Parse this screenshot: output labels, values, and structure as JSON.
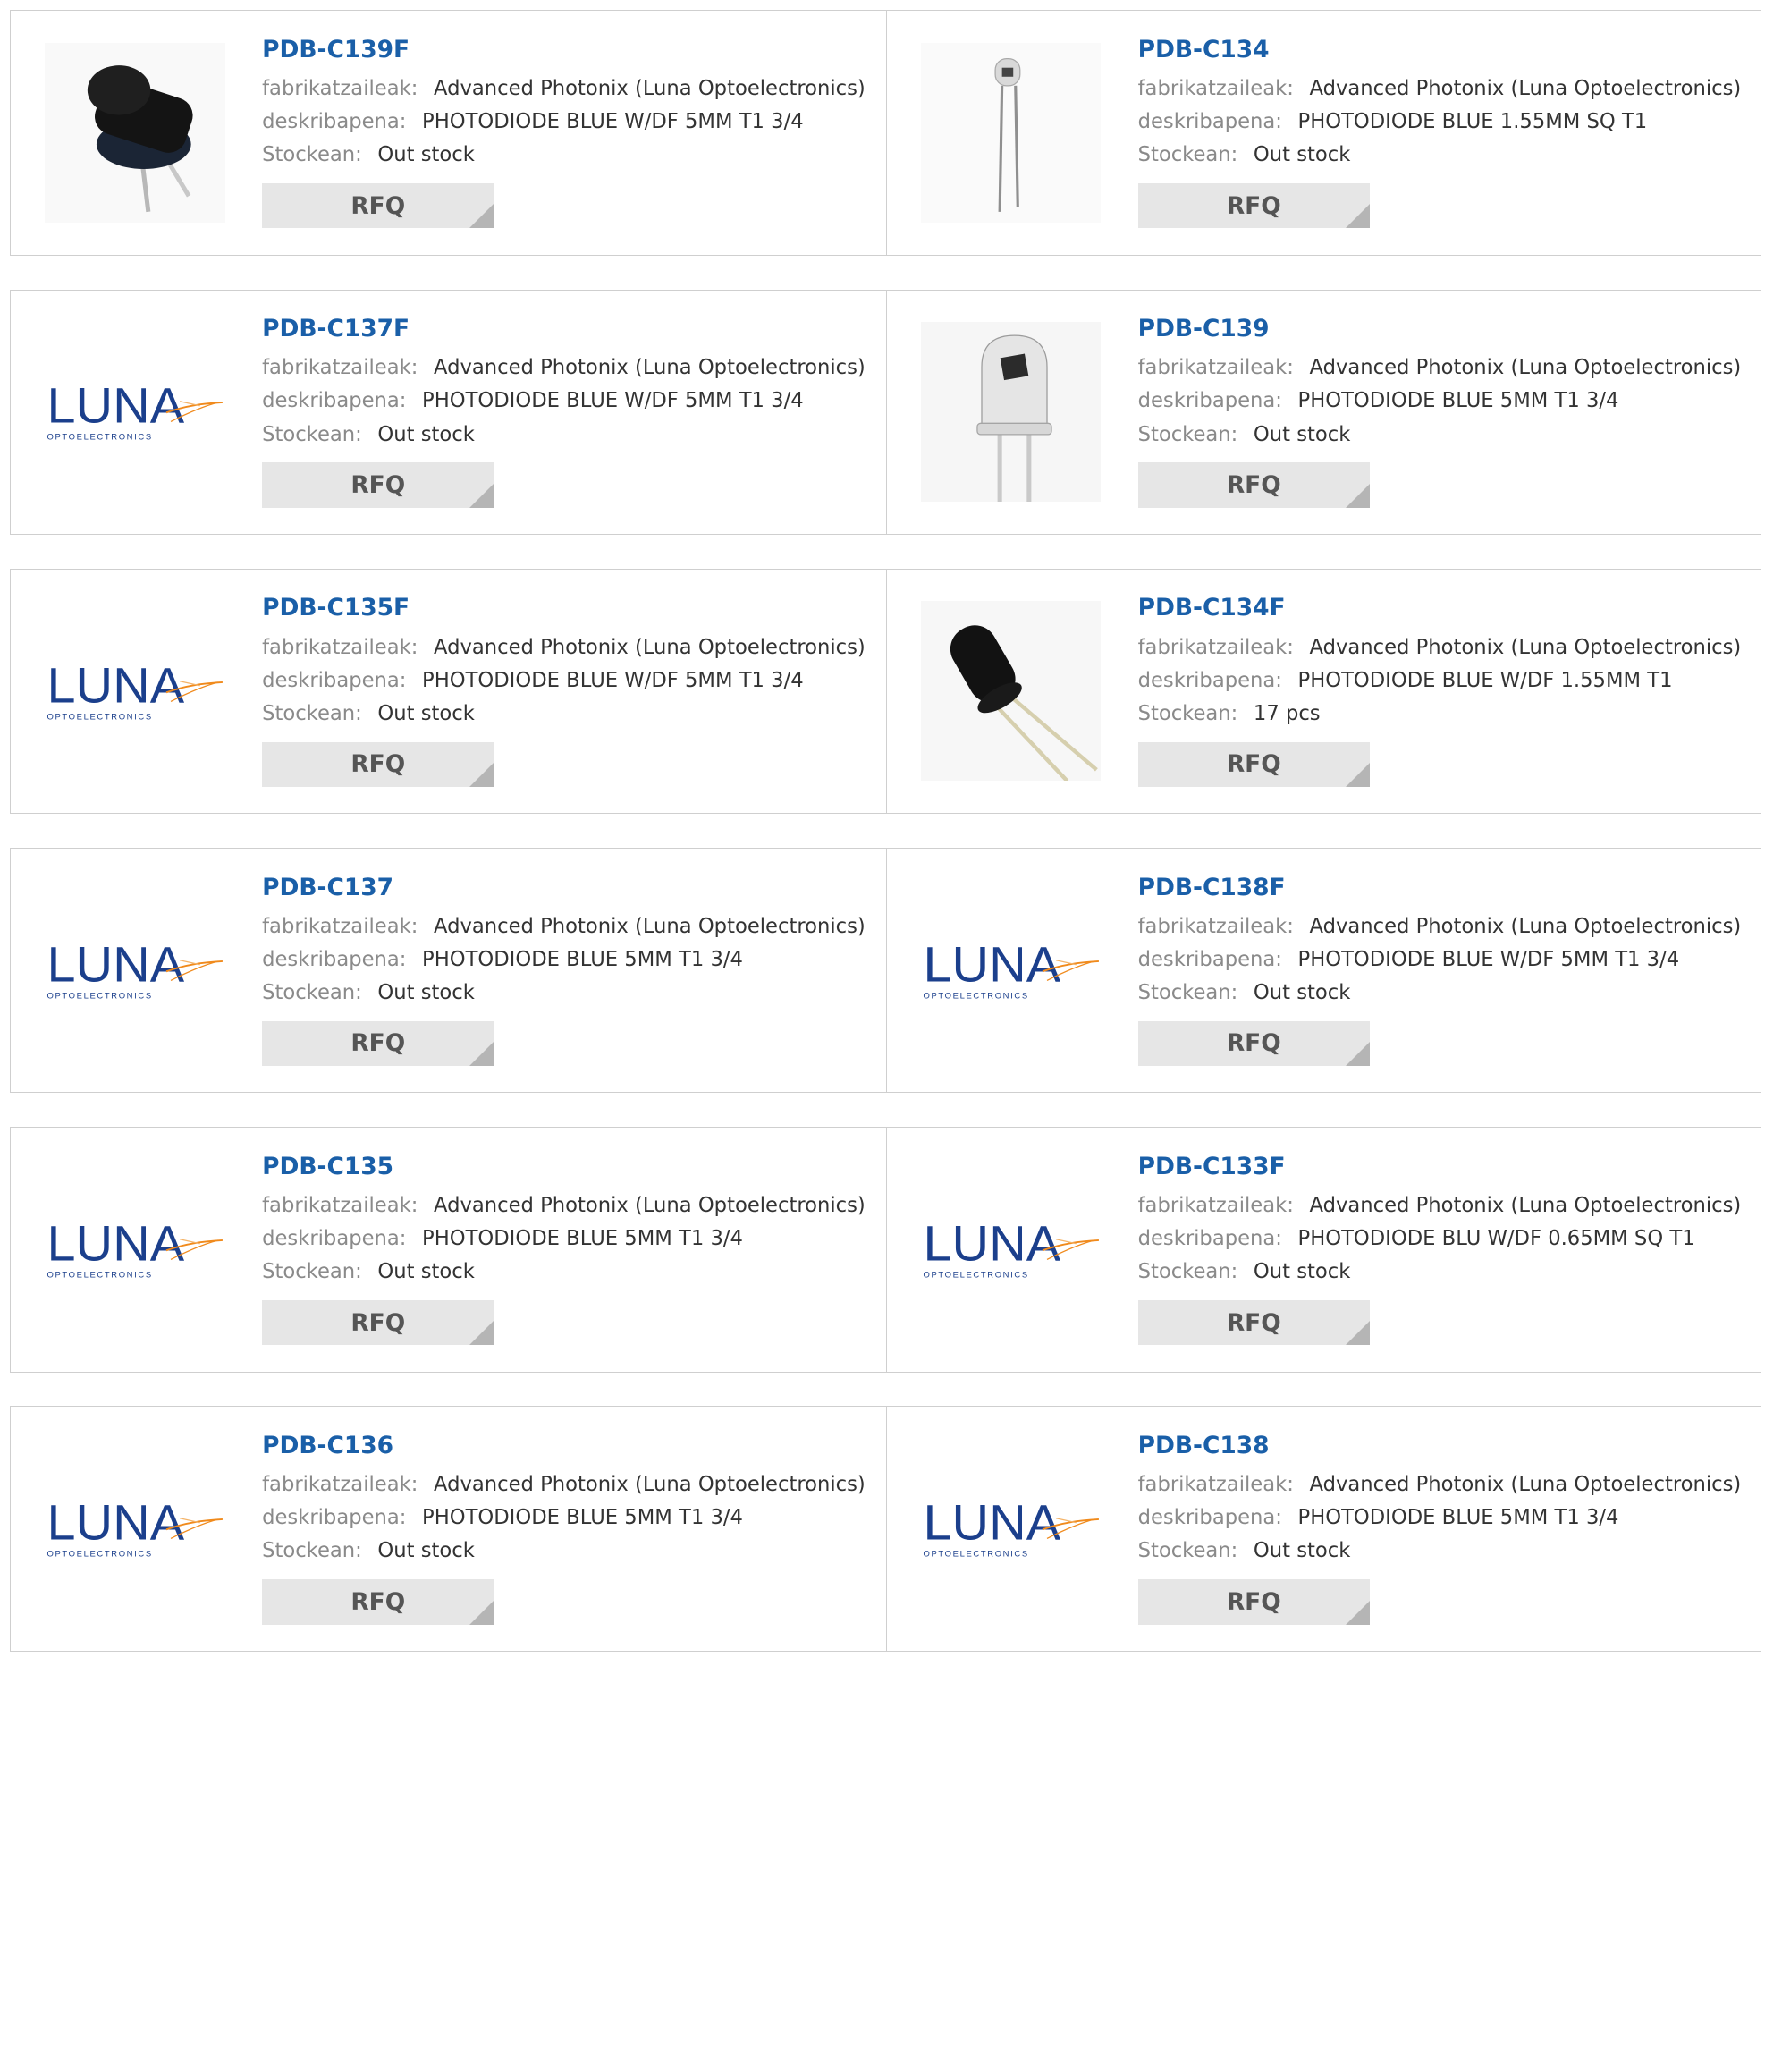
{
  "labels": {
    "manufacturer": "fabrikatzaileak:",
    "description": "deskribapena:",
    "stock": "Stockean:",
    "rfq": "RFQ"
  },
  "logo_text": {
    "main": "LUNA",
    "sub": "OPTOELECTRONICS"
  },
  "products": [
    {
      "pn": "PDB-C139F",
      "manufacturer": "Advanced Photonix (Luna Optoelectronics)",
      "description": "PHOTODIODE BLUE W/DF 5MM T1 3/4",
      "stock": "Out stock",
      "image": "black-photodiode-short"
    },
    {
      "pn": "PDB-C134",
      "manufacturer": "Advanced Photonix (Luna Optoelectronics)",
      "description": "PHOTODIODE BLUE 1.55MM SQ T1",
      "stock": "Out stock",
      "image": "small-clear-photodiode"
    },
    {
      "pn": "PDB-C137F",
      "manufacturer": "Advanced Photonix (Luna Optoelectronics)",
      "description": "PHOTODIODE BLUE W/DF 5MM T1 3/4",
      "stock": "Out stock",
      "image": "luna-logo"
    },
    {
      "pn": "PDB-C139",
      "manufacturer": "Advanced Photonix (Luna Optoelectronics)",
      "description": "PHOTODIODE BLUE 5MM T1 3/4",
      "stock": "Out stock",
      "image": "clear-photodiode"
    },
    {
      "pn": "PDB-C135F",
      "manufacturer": "Advanced Photonix (Luna Optoelectronics)",
      "description": "PHOTODIODE BLUE W/DF 5MM T1 3/4",
      "stock": "Out stock",
      "image": "luna-logo"
    },
    {
      "pn": "PDB-C134F",
      "manufacturer": "Advanced Photonix (Luna Optoelectronics)",
      "description": "PHOTODIODE BLUE W/DF 1.55MM T1",
      "stock": "17 pcs",
      "image": "black-photodiode-tilted"
    },
    {
      "pn": "PDB-C137",
      "manufacturer": "Advanced Photonix (Luna Optoelectronics)",
      "description": "PHOTODIODE BLUE 5MM T1 3/4",
      "stock": "Out stock",
      "image": "luna-logo"
    },
    {
      "pn": "PDB-C138F",
      "manufacturer": "Advanced Photonix (Luna Optoelectronics)",
      "description": "PHOTODIODE BLUE W/DF 5MM T1 3/4",
      "stock": "Out stock",
      "image": "luna-logo"
    },
    {
      "pn": "PDB-C135",
      "manufacturer": "Advanced Photonix (Luna Optoelectronics)",
      "description": "PHOTODIODE BLUE 5MM T1 3/4",
      "stock": "Out stock",
      "image": "luna-logo"
    },
    {
      "pn": "PDB-C133F",
      "manufacturer": "Advanced Photonix (Luna Optoelectronics)",
      "description": "PHOTODIODE BLU W/DF 0.65MM SQ T1",
      "stock": "Out stock",
      "image": "luna-logo"
    },
    {
      "pn": "PDB-C136",
      "manufacturer": "Advanced Photonix (Luna Optoelectronics)",
      "description": "PHOTODIODE BLUE 5MM T1 3/4",
      "stock": "Out stock",
      "image": "luna-logo"
    },
    {
      "pn": "PDB-C138",
      "manufacturer": "Advanced Photonix (Luna Optoelectronics)",
      "description": "PHOTODIODE BLUE 5MM T1 3/4",
      "stock": "Out stock",
      "image": "luna-logo"
    }
  ],
  "colors": {
    "link": "#1a5fa8",
    "label": "#8a8a8a",
    "value": "#333333",
    "button_bg": "#e6e6e6",
    "border": "#cfcfcf",
    "logo_blue": "#1b3f8c",
    "logo_orange": "#f08a1c"
  }
}
